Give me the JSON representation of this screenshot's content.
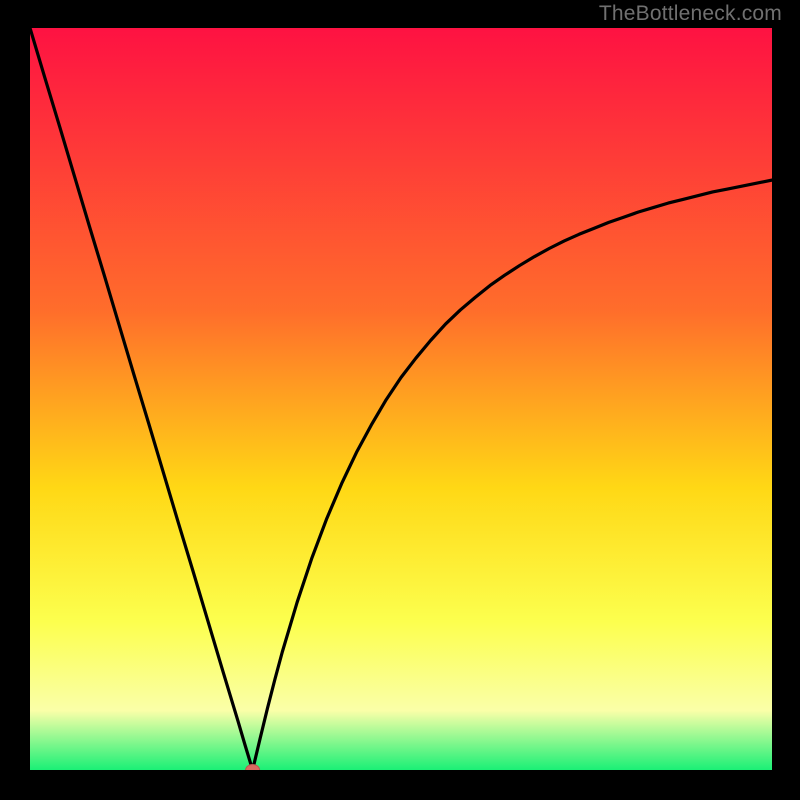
{
  "watermark": "TheBottleneck.com",
  "colors": {
    "frame": "#000000",
    "gradient_top": "#fe1242",
    "gradient_mid1": "#ff6d2b",
    "gradient_mid2": "#ffd815",
    "gradient_mid3": "#fcff4e",
    "gradient_mid4": "#faffa8",
    "gradient_bottom": "#1af076",
    "curve_stroke": "#000000",
    "marker_fill": "#d96a60",
    "marker_stroke": "#b9574f"
  },
  "chart_data": {
    "type": "line",
    "title": "",
    "xlabel": "",
    "ylabel": "",
    "xlim": [
      0,
      100
    ],
    "ylim": [
      0,
      100
    ],
    "grid": false,
    "legend": false,
    "minimum_marker": {
      "x": 30,
      "y": 0
    },
    "x": [
      0,
      2,
      4,
      6,
      8,
      10,
      12,
      14,
      16,
      18,
      20,
      22,
      24,
      26,
      28,
      29,
      30,
      31,
      32,
      33,
      34,
      36,
      38,
      40,
      42,
      44,
      46,
      48,
      50,
      52,
      54,
      56,
      58,
      60,
      62,
      64,
      66,
      68,
      70,
      72,
      74,
      76,
      78,
      80,
      82,
      84,
      86,
      88,
      90,
      92,
      94,
      96,
      98,
      100
    ],
    "y": [
      100,
      93.3,
      86.7,
      80,
      73.3,
      66.7,
      60,
      53.3,
      46.7,
      40,
      33.3,
      26.7,
      20,
      13.3,
      6.7,
      3.3,
      0,
      4.2,
      8.3,
      12.2,
      15.9,
      22.6,
      28.6,
      33.9,
      38.6,
      42.8,
      46.5,
      49.9,
      52.9,
      55.5,
      57.9,
      60.1,
      62.0,
      63.7,
      65.3,
      66.7,
      68.0,
      69.2,
      70.3,
      71.3,
      72.2,
      73.0,
      73.8,
      74.5,
      75.2,
      75.8,
      76.4,
      76.9,
      77.4,
      77.9,
      78.3,
      78.7,
      79.1,
      79.5
    ]
  }
}
